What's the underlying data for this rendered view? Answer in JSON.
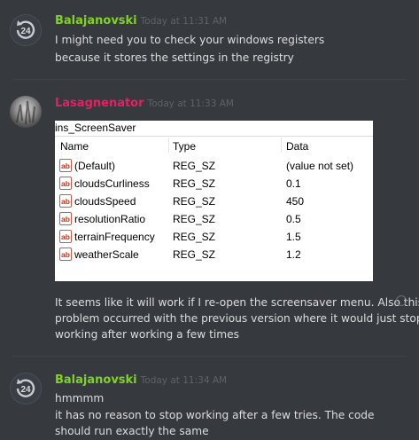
{
  "messages": [
    {
      "author": "Balajanovski",
      "author_color": "#7fd324",
      "timestamp": "Today at 11:31 AM",
      "avatar": "refresh-24-icon",
      "avatar_text": "24",
      "lines": [
        "I might need you to check your windows registers",
        "because it stores the settings in the registry"
      ]
    },
    {
      "author": "Lasagnenator",
      "author_color": "#e91e63",
      "timestamp": "Today at 11:33 AM",
      "avatar": "photo-avatar",
      "attachment": {
        "key_name": "ins_ScreenSaver",
        "columns": [
          "Name",
          "Type",
          "Data"
        ],
        "rows": [
          {
            "name": "(Default)",
            "type": "REG_SZ",
            "data": "(value not set)"
          },
          {
            "name": "cloudsCurliness",
            "type": "REG_SZ",
            "data": "0.1"
          },
          {
            "name": "cloudsSpeed",
            "type": "REG_SZ",
            "data": "450"
          },
          {
            "name": "resolutionRatio",
            "type": "REG_SZ",
            "data": "0.5"
          },
          {
            "name": "terrainFrequency",
            "type": "REG_SZ",
            "data": "1.5"
          },
          {
            "name": "weatherScale",
            "type": "REG_SZ",
            "data": "1.2"
          }
        ],
        "row_icon": "ab-string-icon",
        "row_icon_text": "ab"
      },
      "lines": [
        "It seems like it will work if I re-open the screensaver menu. Also this",
        "problem occurred with the previous version where it would just stop",
        "working after working a few times"
      ]
    },
    {
      "author": "Balajanovski",
      "author_color": "#7fd324",
      "timestamp": "Today at 11:34 AM",
      "avatar": "refresh-24-icon",
      "avatar_text": "24",
      "lines": [
        "hmmmm",
        "it has no reason to stop working after a few tries. The code",
        "should run exactly the same"
      ]
    }
  ],
  "reaction_icon": "add-reaction-icon"
}
